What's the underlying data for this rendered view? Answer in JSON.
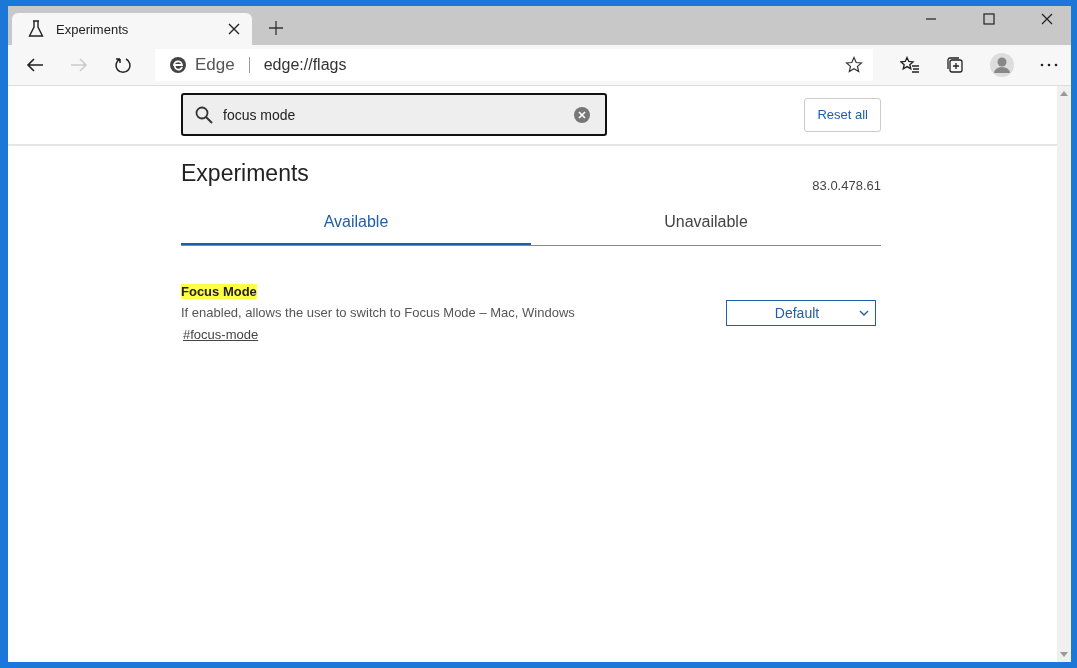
{
  "browser_tab": {
    "title": "Experiments",
    "selected": true
  },
  "address_bar": {
    "site_label": "Edge",
    "url": "edge://flags"
  },
  "search": {
    "value": "focus mode"
  },
  "reset_button": "Reset all",
  "page": {
    "title": "Experiments",
    "version": "83.0.478.61"
  },
  "tabs": [
    {
      "label": "Available",
      "selected": true
    },
    {
      "label": "Unavailable",
      "selected": false
    }
  ],
  "flags": [
    {
      "title": "Focus Mode",
      "highlighted": true,
      "description": "If enabled, allows the user to switch to Focus Mode – Mac, Windows",
      "link": "#focus-mode",
      "value": "Default"
    }
  ]
}
